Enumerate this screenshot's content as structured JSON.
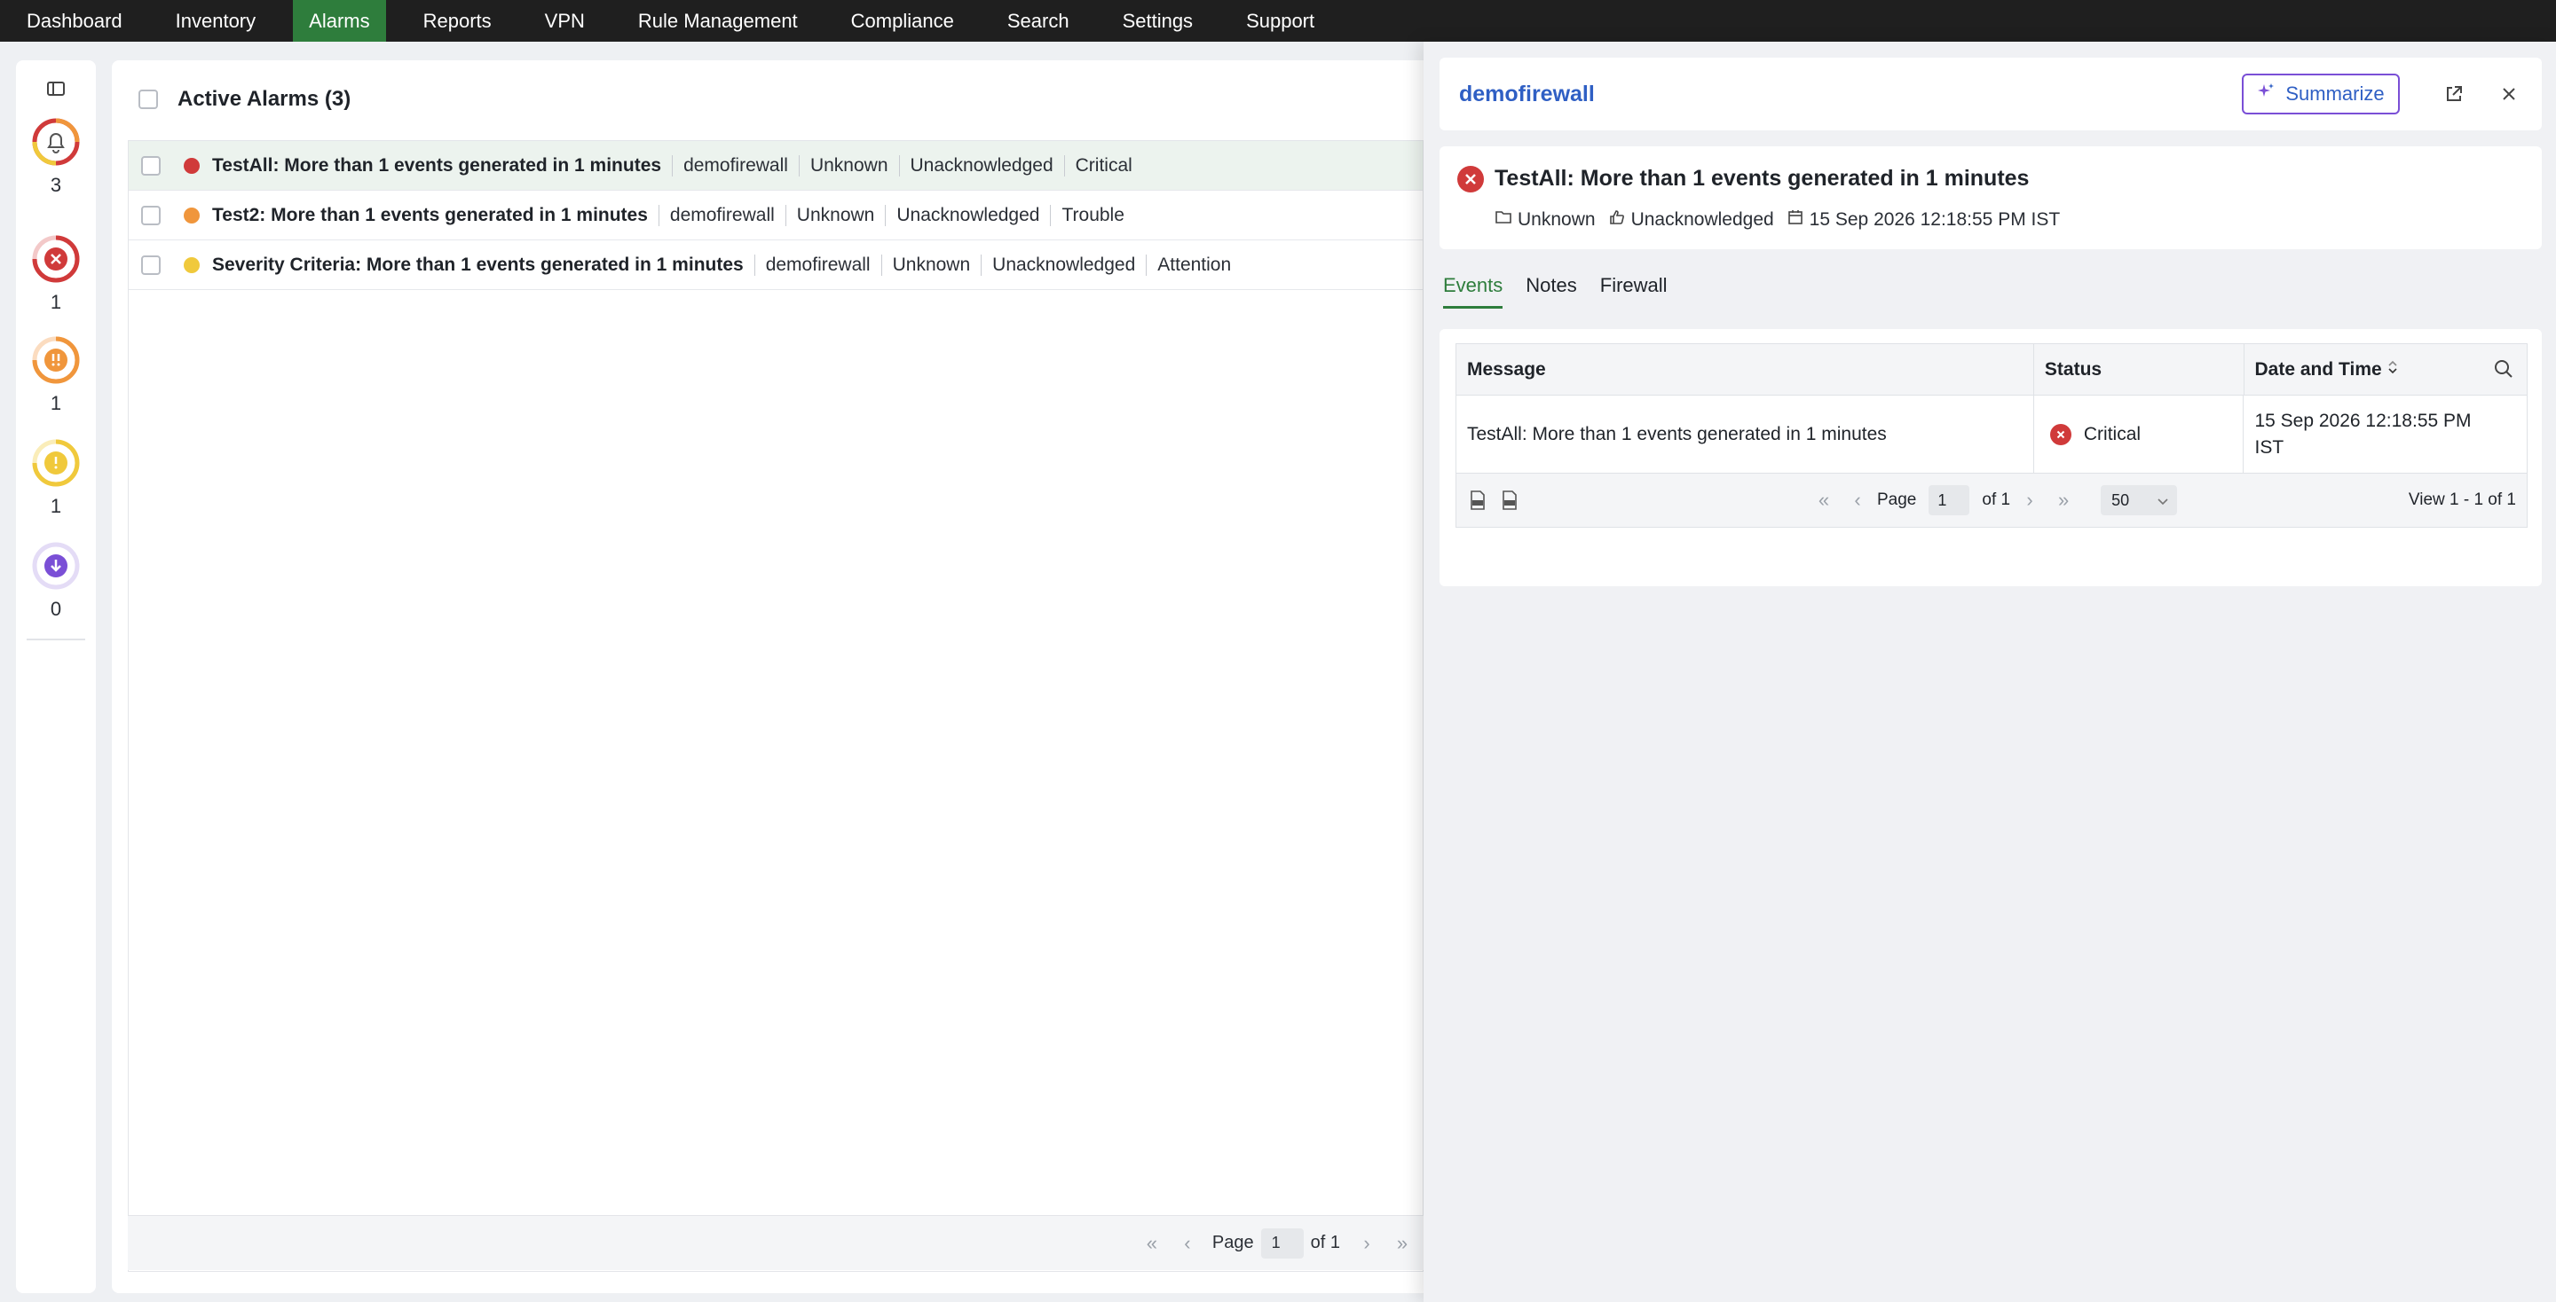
{
  "nav": {
    "items": [
      "Dashboard",
      "Inventory",
      "Alarms",
      "Reports",
      "VPN",
      "Rule Management",
      "Compliance",
      "Search",
      "Settings",
      "Support"
    ],
    "active": "Alarms"
  },
  "rail": {
    "stats": [
      {
        "name": "total",
        "icon": "bell-icon",
        "count": "3",
        "color": "#e8a23a"
      },
      {
        "name": "critical",
        "icon": "x-circle-icon",
        "count": "1",
        "color": "#d03a3a"
      },
      {
        "name": "trouble",
        "icon": "double-exclamation-icon",
        "count": "1",
        "color": "#f0963c"
      },
      {
        "name": "attention",
        "icon": "exclamation-icon",
        "count": "1",
        "color": "#f0c93c"
      },
      {
        "name": "clear",
        "icon": "down-arrow-icon",
        "count": "0",
        "color": "#7a4fd6"
      }
    ]
  },
  "main": {
    "title": "Active Alarms (3)",
    "rows": [
      {
        "name": "TestAll: More than 1 events generated in 1 minutes",
        "device": "demofirewall",
        "category": "Unknown",
        "ack": "Unacknowledged",
        "severity": "Critical",
        "color": "#d03a3a"
      },
      {
        "name": "Test2: More than 1 events generated in 1 minutes",
        "device": "demofirewall",
        "category": "Unknown",
        "ack": "Unacknowledged",
        "severity": "Trouble",
        "color": "#f0963c"
      },
      {
        "name": "Severity Criteria: More than 1 events generated in 1 minutes",
        "device": "demofirewall",
        "category": "Unknown",
        "ack": "Unacknowledged",
        "severity": "Attention",
        "color": "#f0c93c"
      }
    ],
    "pager": {
      "page_label": "Page",
      "page": "1",
      "of": "of 1"
    }
  },
  "drawer": {
    "device": "demofirewall",
    "summarize_label": "Summarize",
    "alarm_title": "TestAll: More than 1 events generated in 1 minutes",
    "category": "Unknown",
    "ack": "Unacknowledged",
    "datetime": "15 Sep 2026 12:18:55 PM IST",
    "tabs": [
      "Events",
      "Notes",
      "Firewall"
    ],
    "active_tab": "Events",
    "table": {
      "headers": [
        "Message",
        "Status",
        "Date and Time"
      ],
      "rows": [
        {
          "message": "TestAll: More than 1 events generated in 1 minutes",
          "status": "Critical",
          "datetime": "15 Sep 2026 12:18:55 PM IST"
        }
      ],
      "pager": {
        "page_label": "Page",
        "page": "1",
        "of": "of 1",
        "page_size": "50",
        "view": "View 1 - 1 of 1"
      },
      "exports": [
        "CSV",
        "XLS"
      ]
    }
  },
  "colors": {
    "accent": "#2e7d3c",
    "link": "#2f5fc4",
    "summarize_border": "#7a4fd6"
  }
}
